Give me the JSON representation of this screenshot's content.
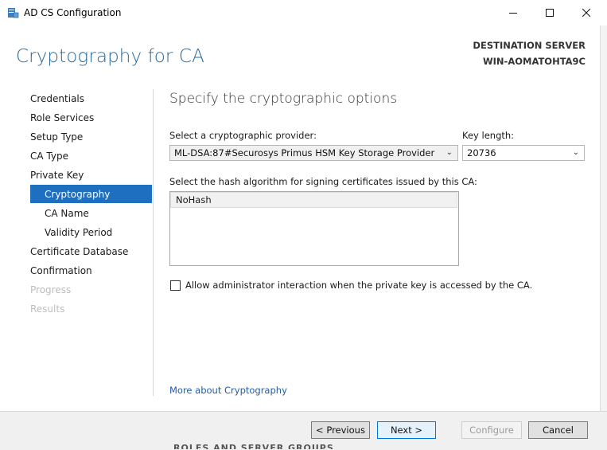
{
  "window": {
    "title": "AD CS Configuration"
  },
  "header": {
    "page_title": "Cryptography for CA",
    "destination_label": "DESTINATION SERVER",
    "destination_server": "WIN-AOMATOHTA9C"
  },
  "nav": {
    "items": [
      {
        "label": "Credentials",
        "state": "normal"
      },
      {
        "label": "Role Services",
        "state": "normal"
      },
      {
        "label": "Setup Type",
        "state": "normal"
      },
      {
        "label": "CA Type",
        "state": "normal"
      },
      {
        "label": "Private Key",
        "state": "normal"
      },
      {
        "label": "Cryptography",
        "state": "selected"
      },
      {
        "label": "CA Name",
        "state": "normal"
      },
      {
        "label": "Validity Period",
        "state": "normal"
      },
      {
        "label": "Certificate Database",
        "state": "normal"
      },
      {
        "label": "Confirmation",
        "state": "normal"
      },
      {
        "label": "Progress",
        "state": "disabled"
      },
      {
        "label": "Results",
        "state": "disabled"
      }
    ]
  },
  "main": {
    "heading": "Specify the cryptographic options",
    "provider_label": "Select a cryptographic provider:",
    "provider_value": "ML-DSA:87#Securosys Primus HSM Key Storage Provider",
    "key_length_label": "Key length:",
    "key_length_value": "20736",
    "hash_label": "Select the hash algorithm for signing certificates issued by this CA:",
    "hash_items": [
      "NoHash"
    ],
    "admin_interaction_label": "Allow administrator interaction when the private key is accessed by the CA.",
    "admin_interaction_checked": false,
    "more_link": "More about Cryptography"
  },
  "footer": {
    "previous_label": "< Previous",
    "next_label": "Next >",
    "configure_label": "Configure",
    "cancel_label": "Cancel"
  },
  "background": {
    "partial_text": "ROLES AND SERVER GROUPS"
  },
  "colors": {
    "accent": "#1f6fc0",
    "title_blue": "#2a6a9c",
    "link": "#1f5da8"
  }
}
